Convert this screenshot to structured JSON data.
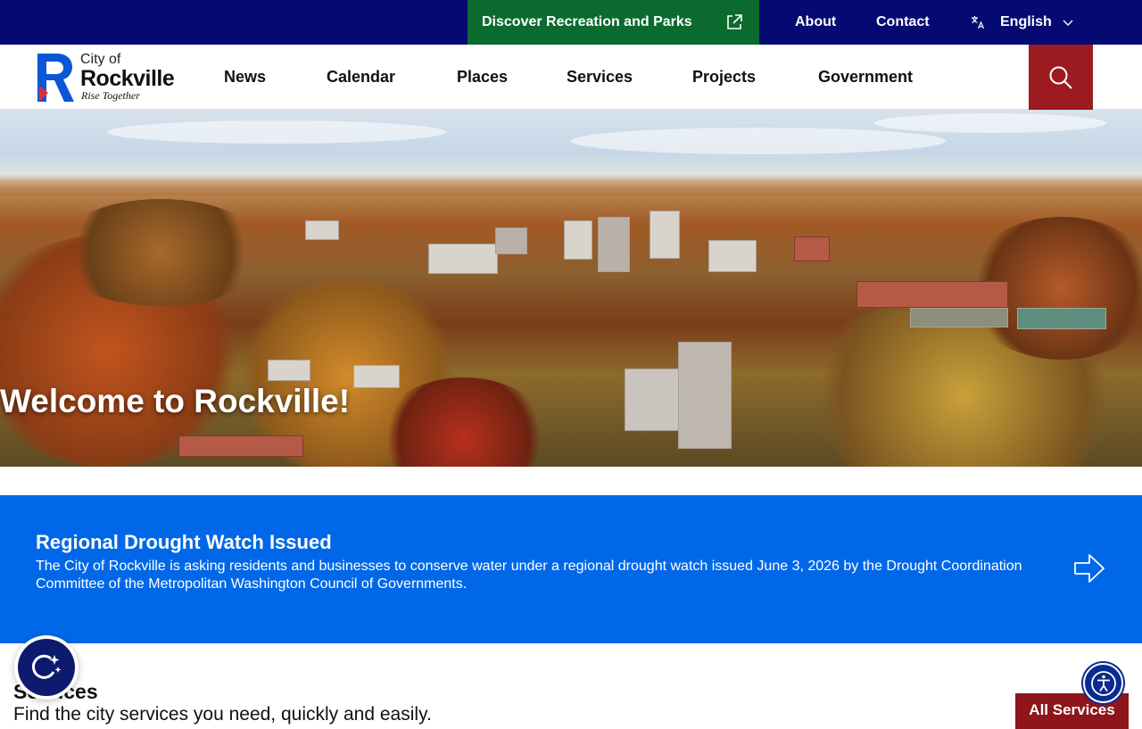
{
  "topbar": {
    "recreation_label": "Discover Recreation and Parks",
    "about_label": "About",
    "contact_label": "Contact",
    "language_label": "English"
  },
  "logo": {
    "line1": "City of",
    "line2": "Rockville",
    "line3": "Rise Together"
  },
  "nav": {
    "items": [
      "News",
      "Calendar",
      "Places",
      "Services",
      "Projects",
      "Government"
    ]
  },
  "hero": {
    "title": "Welcome to Rockville!"
  },
  "alert": {
    "title": "Regional Drought Watch Issued",
    "body": "The City of Rockville is asking residents and businesses to conserve water under a regional drought watch issued June 3, 2026 by the Drought Coordination Committee of the Metropolitan Washington Council of Governments."
  },
  "services": {
    "title": "Services",
    "subtitle": "Find the city services you need, quickly and easily.",
    "all_label": "All Services"
  },
  "colors": {
    "topbar": "#050a73",
    "recreation": "#0b6b2e",
    "search": "#9c1b20",
    "alert": "#0068e8",
    "all_services": "#8e1519"
  },
  "icons": {
    "external": "external-link-icon",
    "translate": "translate-icon",
    "chevron": "chevron-down-icon",
    "search": "search-icon",
    "arrow": "arrow-right-icon",
    "ai": "ai-assistant-icon",
    "accessibility": "accessibility-icon"
  }
}
